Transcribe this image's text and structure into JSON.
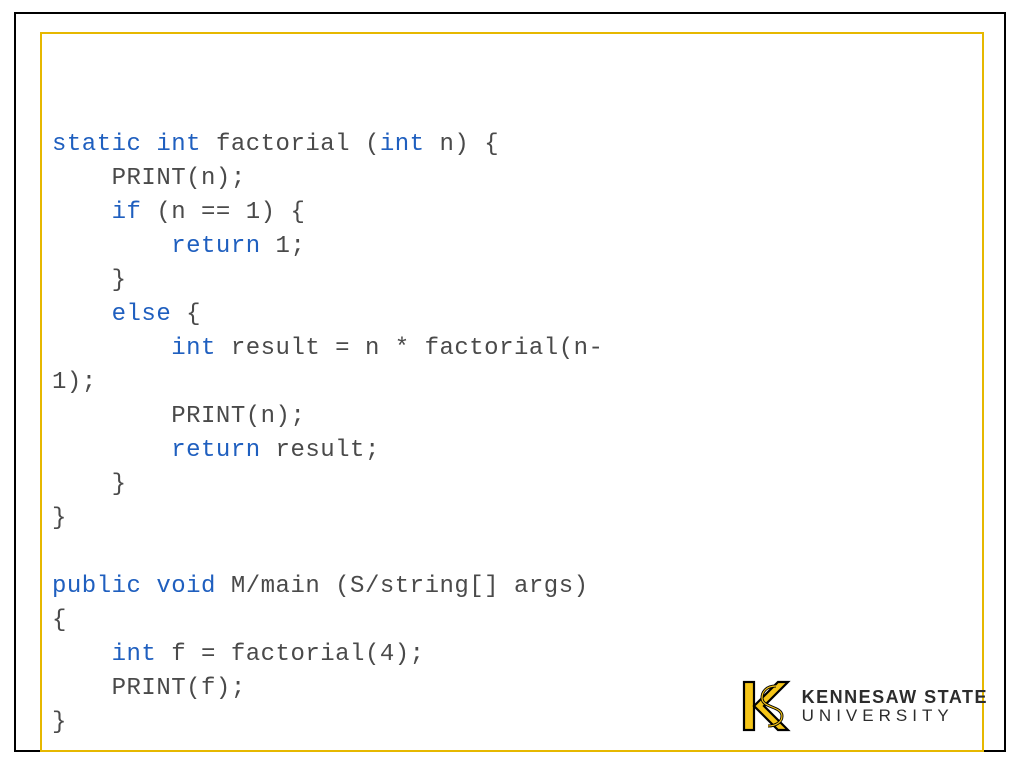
{
  "code": {
    "line1_kw1": "static",
    "line1_kw2": "int",
    "line1_rest": " factorial (",
    "line1_kw3": "int",
    "line1_rest2": " n) {",
    "line2": "    PRINT(n);",
    "line3_pre": "    ",
    "line3_kw": "if",
    "line3_rest": " (n == 1) {",
    "line4_pre": "        ",
    "line4_kw": "return",
    "line4_rest": " 1;",
    "line5": "    }",
    "line6_pre": "    ",
    "line6_kw": "else",
    "line6_rest": " {",
    "line7_pre": "        ",
    "line7_kw": "int",
    "line7_rest": " result = n * factorial(n-",
    "line8": "1);",
    "line9": "        PRINT(n);",
    "line10_pre": "        ",
    "line10_kw": "return",
    "line10_rest": " result;",
    "line11": "    }",
    "line12": "}",
    "line_blank": "",
    "line13_kw1": "public",
    "line13_kw2": "void",
    "line13_rest": " M/main (S/string[] args)",
    "line14": "{",
    "line15_pre": "    ",
    "line15_kw": "int",
    "line15_rest": " f = factorial(4);",
    "line16": "    PRINT(f);",
    "line17": "}"
  },
  "logo": {
    "line1": "KENNESAW STATE",
    "line2": "UNIVERSITY"
  }
}
